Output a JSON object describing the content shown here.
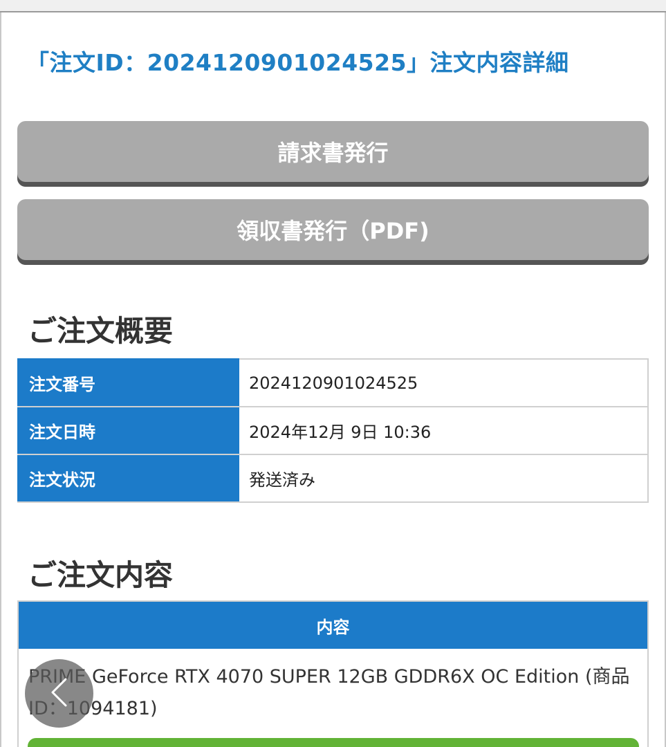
{
  "page": {
    "title": "「注文ID：2024120901024525」注文内容詳細"
  },
  "actions": {
    "invoice_label": "請求書発行",
    "receipt_label": "領収書発行（PDF)"
  },
  "summary": {
    "heading": "ご注文概要",
    "rows": [
      {
        "label": "注文番号",
        "value": "2024120901024525"
      },
      {
        "label": "注文日時",
        "value": "2024年12月 9日 10:36"
      },
      {
        "label": "注文状況",
        "value": "発送済み"
      }
    ]
  },
  "contents": {
    "heading": "ご注文内容",
    "column_header": "内容",
    "items": [
      {
        "text": "PRIME GeForce RTX 4070 SUPER 12GB GDDR6X OC Edition (商品ID：1094181)"
      }
    ]
  },
  "colors": {
    "accent_blue": "#1c7bc9",
    "title_blue": "#1f7fc4",
    "button_gray": "#aaaaaa",
    "action_green": "#62b336"
  },
  "icons": {
    "back": "chevron-left-icon"
  }
}
